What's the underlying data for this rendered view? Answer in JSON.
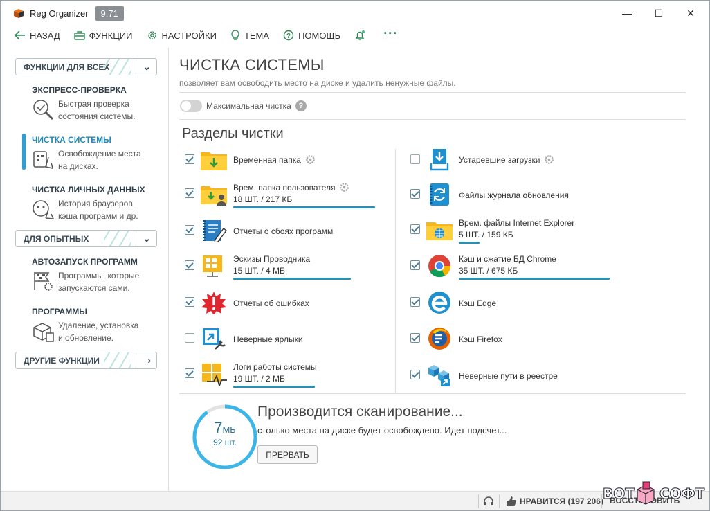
{
  "app": {
    "title": "Reg Organizer",
    "version": "9.71"
  },
  "window_controls": {
    "minimize": "—",
    "maximize": "☐",
    "close": "✕"
  },
  "menu": {
    "back": "НАЗАД",
    "functions": "ФУНКЦИИ",
    "settings": "НАСТРОЙКИ",
    "theme": "ТЕМА",
    "help": "ПОМОЩЬ",
    "more": "···"
  },
  "sidebar": {
    "groups": [
      {
        "label": "ФУНКЦИИ ДЛЯ ВСЕХ",
        "chevron": "⌄"
      },
      {
        "label": "ДЛЯ ОПЫТНЫХ",
        "chevron": "⌄"
      },
      {
        "label": "ДРУГИЕ ФУНКЦИИ",
        "chevron": "›"
      }
    ],
    "items": [
      {
        "title": "ЭКСПРЕСС-ПРОВЕРКА",
        "desc1": "Быстрая проверка",
        "desc2": "состояния системы."
      },
      {
        "title": "ЧИСТКА СИСТЕМЫ",
        "desc1": "Освобождение места",
        "desc2": "на дисках."
      },
      {
        "title": "ЧИСТКА ЛИЧНЫХ ДАННЫХ",
        "desc1": "История браузеров,",
        "desc2": "кэша программ и др."
      },
      {
        "title": "АВТОЗАПУСК ПРОГРАММ",
        "desc1": "Программы, которые",
        "desc2": "запускаются сами."
      },
      {
        "title": "ПРОГРАММЫ",
        "desc1": "Удаление, установка",
        "desc2": "и обновление."
      }
    ]
  },
  "main": {
    "title": "ЧИСТКА СИСТЕМЫ",
    "subtitle": "позволяет вам освободить место на диске и удалить ненужные файлы.",
    "max_clean_label": "Максимальная чистка",
    "help_glyph": "?",
    "sections_title": "Разделы чистки",
    "left_items": [
      {
        "name": "Временная папка",
        "checked": true,
        "stats": "",
        "gear": true
      },
      {
        "name": "Врем. папка пользователя",
        "checked": true,
        "stats": "18 ШТ. / 217 КБ",
        "gear": true,
        "bar": 0.85
      },
      {
        "name": "Отчеты о сбоях программ",
        "checked": true,
        "stats": ""
      },
      {
        "name": "Эскизы Проводника",
        "checked": true,
        "stats": "15 ШТ. / 4 МБ",
        "bar": 0.7
      },
      {
        "name": "Отчеты об ошибках",
        "checked": true,
        "stats": ""
      },
      {
        "name": "Неверные ярлыки",
        "checked": false,
        "stats": ""
      },
      {
        "name": "Логи работы системы",
        "checked": true,
        "stats": "19 ШТ. / 2 МБ",
        "bar": 0.5
      }
    ],
    "right_items": [
      {
        "name": "Устаревшие загрузки",
        "checked": false,
        "stats": "",
        "gear": true
      },
      {
        "name": "Файлы журнала обновления",
        "checked": true,
        "stats": ""
      },
      {
        "name": "Врем. файлы Internet Explorer",
        "checked": true,
        "stats": "5 ШТ. / 159 КБ",
        "bar": 0.14
      },
      {
        "name": "Кэш и сжатие БД Chrome",
        "checked": true,
        "stats": "35 ШТ. / 675 КБ",
        "bar": 1.0
      },
      {
        "name": "Кэш Edge",
        "checked": true,
        "stats": ""
      },
      {
        "name": "Кэш Firefox",
        "checked": true,
        "stats": ""
      },
      {
        "name": "Неверные пути в реестре",
        "checked": true,
        "stats": ""
      }
    ]
  },
  "scan": {
    "size_value": "7",
    "size_unit": "МБ",
    "count": "92 шт.",
    "progress": 0.9,
    "title": "Производится сканирование...",
    "subtitle": "столько места на диске будет освобождено. Идет подсчет...",
    "abort_label": "ПРЕРВАТЬ"
  },
  "statusbar": {
    "likes": "НРАВИТСЯ (197 206)",
    "command": "ВОССТАНОВИТЬ"
  },
  "watermark": {
    "left": "ВОТ",
    "right": "СОФТ"
  },
  "colors": {
    "accent": "#2b9fd8",
    "bar": "#2a8fb0",
    "ring": "#3cb6e8"
  }
}
